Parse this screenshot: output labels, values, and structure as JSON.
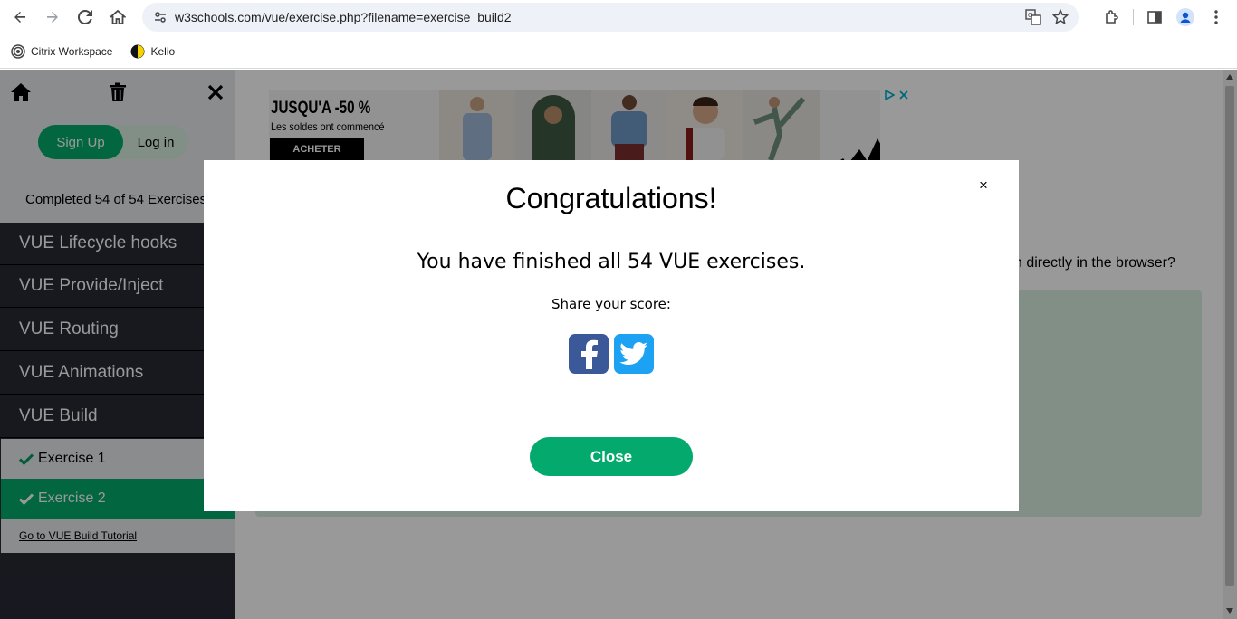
{
  "browser": {
    "url": "w3schools.com/vue/exercise.php?filename=exercise_build2",
    "bookmarks": [
      {
        "label": "Citrix Workspace"
      },
      {
        "label": "Kelio"
      }
    ]
  },
  "sidebar": {
    "signup_label": "Sign Up",
    "login_label": "Log in",
    "completed_text": "Completed 54 of 54 Exercises:",
    "topics": [
      {
        "label": "VUE Lifecycle hooks"
      },
      {
        "label": "VUE Provide/Inject"
      },
      {
        "label": "VUE Routing"
      },
      {
        "label": "VUE Animations"
      },
      {
        "label": "VUE Build"
      }
    ],
    "exercises": [
      {
        "label": "Exercise 1"
      },
      {
        "label": "Exercise 2"
      }
    ],
    "tutorial_link": "Go to VUE Build Tutorial"
  },
  "ad": {
    "title": "JUSQU'A -50 %",
    "subtitle": "Les soldes ont commencé",
    "button": "ACHETER"
  },
  "main": {
    "question_fragment": "n directly in the browser?"
  },
  "modal": {
    "title": "Congratulations!",
    "message": "You have finished all 54 VUE exercises.",
    "share_label": "Share your score:",
    "close_label": "Close",
    "close_x": "×"
  },
  "colors": {
    "accent": "#04aa6d",
    "sidebar_dark": "#282a35",
    "facebook": "#3b5998",
    "twitter": "#1da1f2"
  }
}
